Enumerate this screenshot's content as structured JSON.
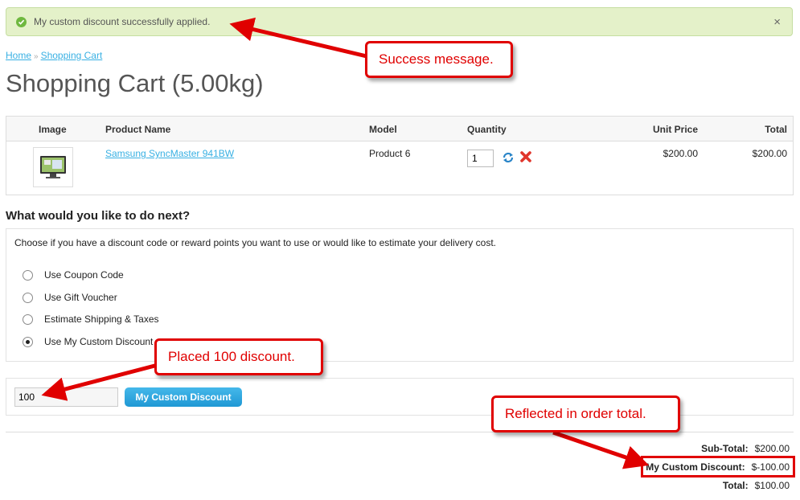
{
  "alert": {
    "message": "My custom discount successfully applied.",
    "close": "×",
    "icon": "check-circle-icon",
    "color": "#e4f1c9"
  },
  "breadcrumb": {
    "home": "Home",
    "separator": "»",
    "current": "Shopping Cart"
  },
  "page": {
    "title": "Shopping Cart  (5.00kg)"
  },
  "cart": {
    "columns": {
      "image": "Image",
      "product": "Product Name",
      "model": "Model",
      "quantity": "Quantity",
      "unit_price": "Unit Price",
      "total": "Total"
    },
    "items": [
      {
        "product": "Samsung SyncMaster 941BW",
        "model": "Product 6",
        "quantity": "1",
        "unit_price": "$200.00",
        "total": "$200.00"
      }
    ]
  },
  "next": {
    "title": "What would you like to do next?",
    "intro": "Choose if you have a discount code or reward points you want to use or would like to estimate your delivery cost.",
    "options": [
      {
        "label": "Use Coupon Code",
        "checked": false
      },
      {
        "label": "Use Gift Voucher",
        "checked": false
      },
      {
        "label": "Estimate Shipping & Taxes",
        "checked": false
      },
      {
        "label": "Use My Custom Discount",
        "checked": true
      }
    ]
  },
  "discount": {
    "value": "100",
    "button": "My Custom Discount"
  },
  "totals": [
    {
      "label": "Sub-Total:",
      "value": "$200.00"
    },
    {
      "label": "My Custom Discount:",
      "value": "$-100.00"
    },
    {
      "label": "Total:",
      "value": "$100.00"
    }
  ],
  "annotations": {
    "success": "Success message.",
    "placed": "Placed 100 discount.",
    "reflected": "Reflected in order total.",
    "color": "#e00000"
  },
  "colors": {
    "link": "#38b0e3",
    "button": "#1f98d4"
  }
}
